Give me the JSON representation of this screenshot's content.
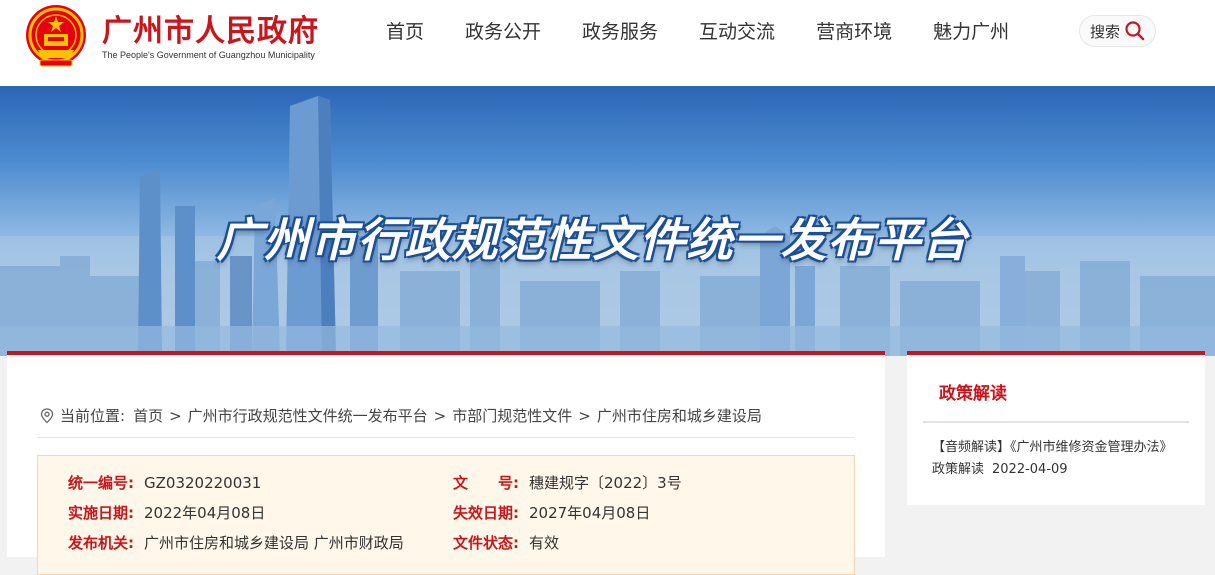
{
  "header": {
    "title": "广州市人民政府",
    "subtitle": "The People's Government of Guangzhou Municipality",
    "nav": [
      "首页",
      "政务公开",
      "政务服务",
      "互动交流",
      "营商环境",
      "魅力广州"
    ],
    "search_label": "搜索"
  },
  "banner": {
    "title": "广州市行政规范性文件统一发布平台"
  },
  "breadcrumb": {
    "prefix": "当前位置:",
    "items": [
      "首页",
      "广州市行政规范性文件统一发布平台",
      "市部门规范性文件",
      "广州市住房和城乡建设局"
    ],
    "separator": ">"
  },
  "doc_info": {
    "rows": [
      {
        "left_label": "统一编号:",
        "left_value": "GZ0320220031",
        "right_label": "文　　号:",
        "right_value": "穗建规字〔2022〕3号"
      },
      {
        "left_label": "实施日期:",
        "left_value": "2022年04月08日",
        "right_label": "失效日期:",
        "right_value": "2027年04月08日"
      },
      {
        "left_label": "发布机关:",
        "left_value": "广州市住房和城乡建设局 广州市财政局",
        "right_label": "文件状态:",
        "right_value": "有效"
      }
    ]
  },
  "sidebar": {
    "title": "政策解读",
    "link_text": "【音频解读】《广州市维修资金管理办法》政策解读",
    "link_date": "2022-04-09"
  },
  "colors": {
    "brand_red": "#c8161d",
    "info_bg": "#fff7ea"
  }
}
